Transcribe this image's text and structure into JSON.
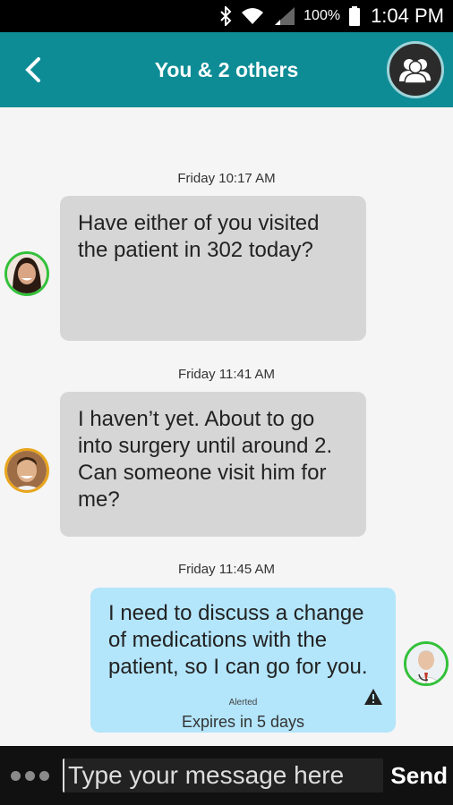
{
  "status_bar": {
    "battery": "100%",
    "time": "1:04 PM"
  },
  "header": {
    "title": "You & 2 others"
  },
  "messages": [
    {
      "timestamp": "Friday 10:17 AM",
      "text": "Have either of you visited the patient in 302 today?",
      "avatar_border": "#33c13a"
    },
    {
      "timestamp": "Friday 11:41 AM",
      "text": "I haven’t yet. About to go into surgery until around 2. Can someone visit him for me?",
      "avatar_border": "#e8a51c"
    },
    {
      "timestamp": "Friday 11:45 AM",
      "text": "I need to discuss a change of medications with the patient, so I can go for you.",
      "alerted": "Alerted",
      "expires": "Expires in 5 days",
      "avatar_border": "#33c13a"
    }
  ],
  "composer": {
    "placeholder": "Type your message here",
    "send_label": "Send"
  },
  "colors": {
    "header": "#0e8c96",
    "incoming_bubble": "#d6d6d6",
    "outgoing_bubble": "#b3e5fb"
  }
}
